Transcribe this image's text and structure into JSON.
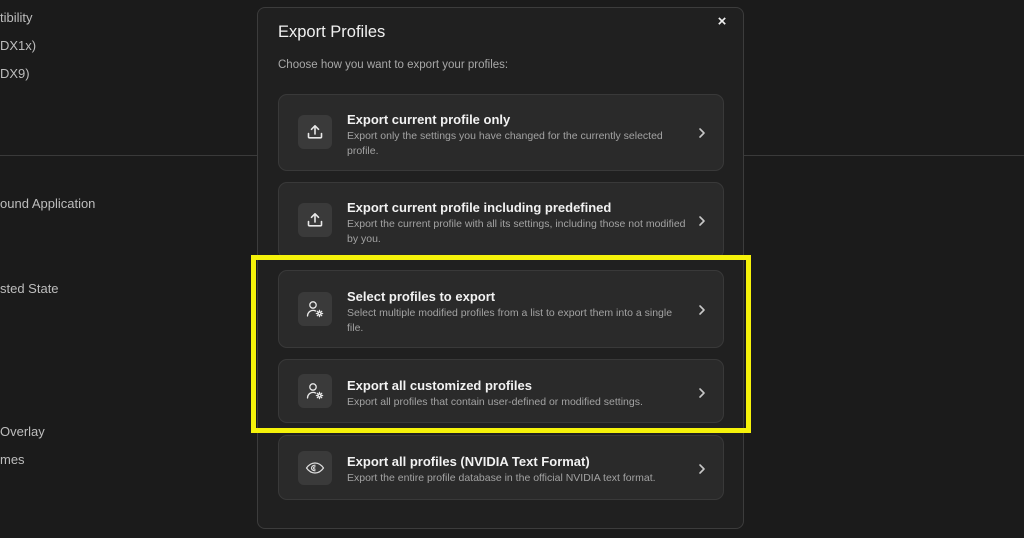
{
  "background": {
    "labels": [
      "tibility",
      "DX1x)",
      "DX9)",
      "ound Application",
      "sted State",
      "Overlay",
      "mes"
    ]
  },
  "dialog": {
    "title": "Export Profiles",
    "close_label": "×",
    "subtitle": "Choose how you want to export your profiles:",
    "options": [
      {
        "title": "Export current profile only",
        "description": "Export only the settings you have changed for the currently selected profile.",
        "icon": "upload-icon"
      },
      {
        "title": "Export current profile including predefined",
        "description": "Export the current profile with all its settings, including those not modified by you.",
        "icon": "upload-icon"
      },
      {
        "title": "Select profiles to export",
        "description": "Select multiple modified profiles from a list to export them into a single file.",
        "icon": "user-gear-icon"
      },
      {
        "title": "Export all customized profiles",
        "description": "Export all profiles that contain user-defined or modified settings.",
        "icon": "user-gear-icon"
      },
      {
        "title": "Export all profiles (NVIDIA Text Format)",
        "description": "Export the entire profile database in the official NVIDIA text format.",
        "icon": "nvidia-eye-icon"
      }
    ]
  },
  "colors": {
    "highlight": "#f5f20a",
    "dialog_bg": "#202020",
    "option_bg": "#2a2a2a"
  }
}
